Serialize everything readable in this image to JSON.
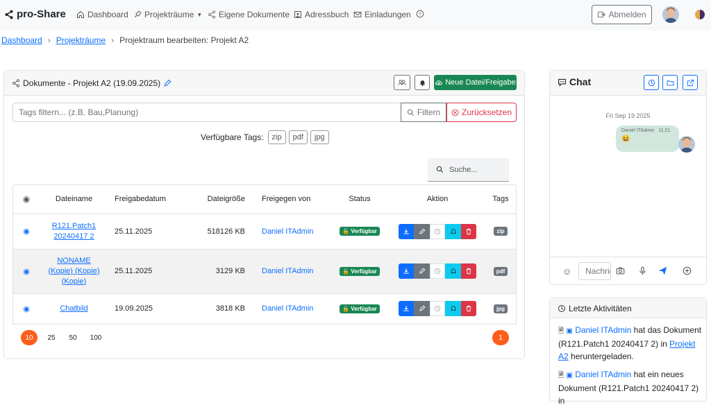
{
  "brand": "pro-Share",
  "nav": {
    "dashboard": "Dashboard",
    "projekt_raeume": "Projekträume",
    "eigene_dokumente": "Eigene Dokumente",
    "adressbuch": "Adressbuch",
    "einladungen": "Einladungen"
  },
  "logout_label": "Abmelden",
  "breadcrumb": {
    "home": "Dashboard",
    "parent": "Projekträume",
    "current": "Projektraum bearbeiten: Projekt A2"
  },
  "documents": {
    "title": "Dokumente - Projekt A2 (19.09.2025)",
    "new_button": "Neue Datei/Freigabe",
    "filter_placeholder": "Tags filtern... (z.B. Bau,Planung)",
    "filter_button": "Filtern",
    "reset_button": "Zurücksetzen",
    "available_tags_label": "Verfügbare Tags:",
    "available_tags": [
      "zip",
      "pdf",
      "jpg"
    ],
    "search_label": "Suche...",
    "columns": [
      "Dateiname",
      "Freigabedatum",
      "Dateigröße",
      "Freigegen von",
      "Status",
      "Aktion",
      "Tags"
    ],
    "rows": [
      {
        "name_lines": [
          "R121.Patch1",
          "20240417 2"
        ],
        "date": "25.11.2025",
        "size": "518126 KB",
        "by": "Daniel ITAdmin",
        "status": "Verfügbar",
        "tag": "zip"
      },
      {
        "name_lines": [
          "NONAME",
          "(Kopie) (Kopie)",
          "(Kopie)"
        ],
        "date": "25.11.2025",
        "size": "3129 KB",
        "by": "Daniel ITAdmin",
        "status": "Verfügbar",
        "tag": "pdf"
      },
      {
        "name_lines": [
          "Chatbild"
        ],
        "date": "19.09.2025",
        "size": "3818 KB",
        "by": "Daniel ITAdmin",
        "status": "Verfügbar",
        "tag": "jpg"
      }
    ],
    "page_sizes": [
      "10",
      "25",
      "50",
      "100"
    ],
    "current_page": "1"
  },
  "chat": {
    "title": "Chat",
    "date": "Fri Sep 19 2025",
    "message_author": "Daniel ITAdmin",
    "message_time": "11:21",
    "message_emoji": "😆",
    "input_placeholder": "Nachricht"
  },
  "activity": {
    "title": "Letzte Aktivitäten",
    "items": [
      {
        "user": "Daniel ITAdmin",
        "text1": "hat das",
        "text2": "Dokument (R121.Patch1 20240417 2) in",
        "link": "Projekt A2",
        "text3": "heruntergeladen."
      },
      {
        "user": "Daniel ITAdmin",
        "text1": "hat ein neues",
        "text2": "Dokument (R121.Patch1 20240417 2) in"
      }
    ]
  },
  "colors": {
    "accent": "#0d6efd",
    "green": "#198754",
    "danger": "#dc3545",
    "info": "#0dcaf0",
    "pager": "#fd5e1b"
  }
}
